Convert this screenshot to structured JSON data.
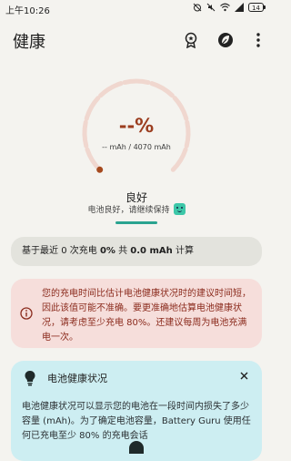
{
  "status_bar": {
    "time": "上午10:26",
    "battery_level": "14"
  },
  "app_bar": {
    "title": "健康",
    "actions": [
      "badge-icon",
      "leaf-icon",
      "more-vert-icon"
    ]
  },
  "gauge": {
    "percent": "--%",
    "capacity": "-- mAh / 4070 mAh",
    "colors": {
      "track": "#f0d7cf",
      "accent": "#a64a1f"
    }
  },
  "health": {
    "label": "良好",
    "description": "电池良好，请继续保持"
  },
  "stats": {
    "prefix": "基于最近",
    "charge_count": "0",
    "charge_label": "次充电",
    "percent": "0%",
    "total_label": "共",
    "capacity": "0.0 mAh",
    "suffix": "计算"
  },
  "warning": {
    "text": "您的充电时间比估计电池健康状况时的建议时间短，因此该值可能不准确。要更准确地估算电池健康状况，请考虑至少充电 80%。还建议每周为电池充满电一次。"
  },
  "info_card": {
    "title": "电池健康状况",
    "body": "电池健康状况可以显示您的电池在一段时间内损失了多少容量 (mAh)。为了确定电池容量，Battery Guru 使用任何已充电至少 80% 的充电会话"
  }
}
